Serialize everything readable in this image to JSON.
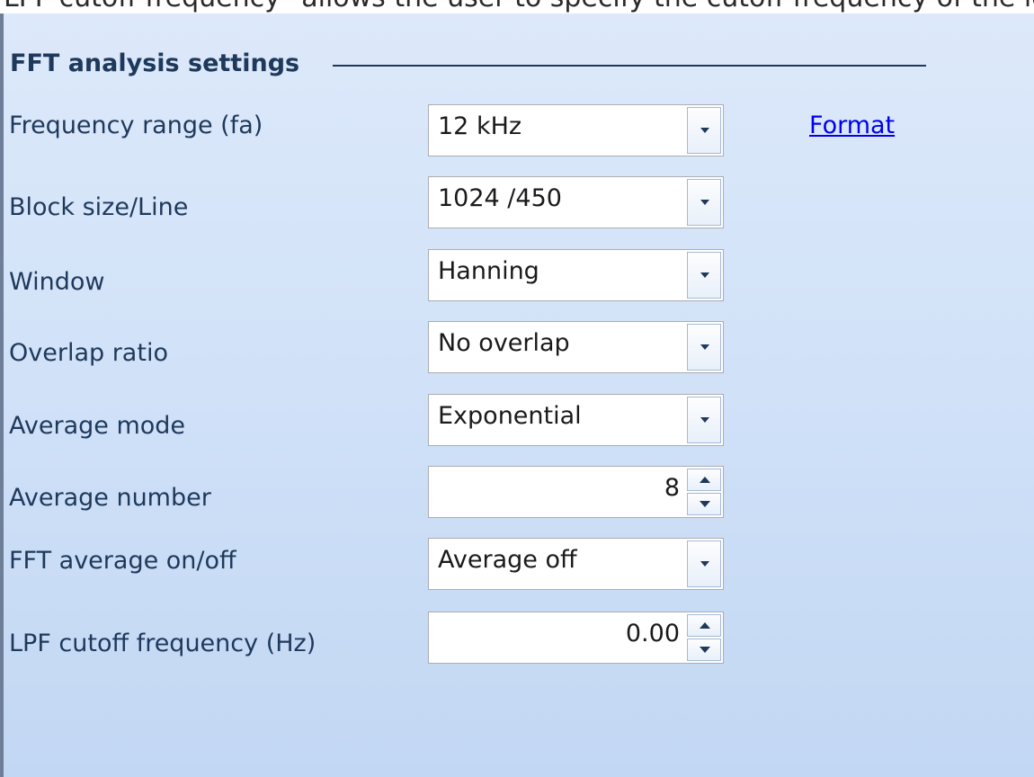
{
  "top_text": "LPF cutoff frequency\" allows the user to specify the cutoff frequency of the low pass fi",
  "group": {
    "title": "FFT analysis settings"
  },
  "format_link": "Format",
  "rows": [
    {
      "label": "Frequency range (fa)",
      "control": "combo",
      "value": "12 kHz"
    },
    {
      "label": "Block size/Line",
      "control": "combo",
      "value": "1024 /450"
    },
    {
      "label": "Window",
      "control": "combo",
      "value": "Hanning"
    },
    {
      "label": "Overlap ratio",
      "control": "combo",
      "value": "No overlap"
    },
    {
      "label": "Average mode",
      "control": "combo",
      "value": "Exponential"
    },
    {
      "label": "Average number",
      "control": "spin",
      "value": "8"
    },
    {
      "label": "FFT average on/off",
      "control": "combo",
      "value": "Average off"
    },
    {
      "label": "LPF cutoff frequency (Hz)",
      "control": "spin",
      "value": "0.00"
    }
  ],
  "icons": {
    "combo_button": "chevron-down-icon",
    "spin_up": "arrow-up-icon",
    "spin_down": "arrow-down-icon"
  },
  "colors": {
    "label_text": "#1e395b",
    "link": "#0000ee",
    "panel_top": "#dde9fa",
    "panel_bottom": "#c2d7f3"
  }
}
